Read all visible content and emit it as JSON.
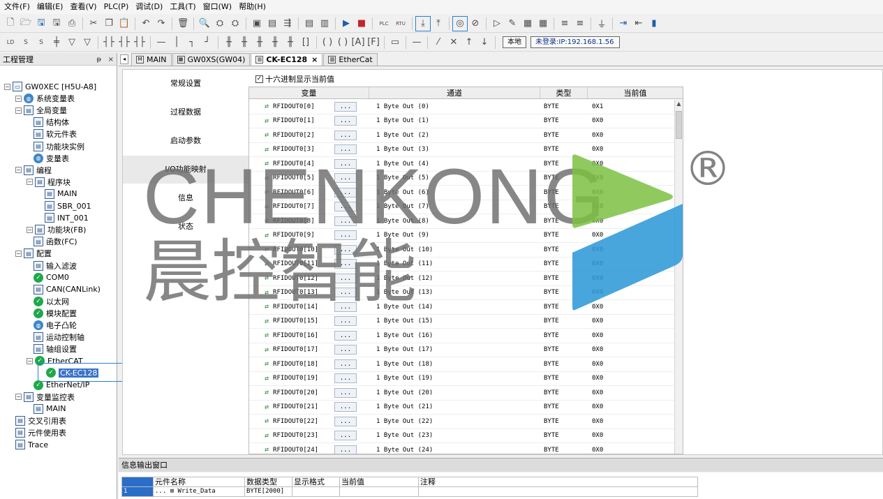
{
  "menu": [
    "文件(F)",
    "编辑(E)",
    "查看(V)",
    "PLC(P)",
    "调试(D)",
    "工具(T)",
    "窗口(W)",
    "帮助(H)"
  ],
  "toolbar": {
    "local_label": "本地",
    "login_label": "未登录:IP:192.168.1.56",
    "plc_label": "PLC",
    "rtu_label": "RTU"
  },
  "tree": {
    "header": "工程管理",
    "pin": "ᵽ",
    "close": "×",
    "nodes": [
      {
        "label": "GW0XEC [H5U-A8]"
      },
      {
        "label": "系统变量表"
      },
      {
        "label": "全局变量"
      },
      {
        "label": "结构体"
      },
      {
        "label": "软元件表"
      },
      {
        "label": "功能块实例"
      },
      {
        "label": "变量表"
      },
      {
        "label": "编程"
      },
      {
        "label": "程序块"
      },
      {
        "label": "MAIN"
      },
      {
        "label": "SBR_001"
      },
      {
        "label": "INT_001"
      },
      {
        "label": "功能块(FB)"
      },
      {
        "label": "函数(FC)"
      },
      {
        "label": "配置"
      },
      {
        "label": "输入滤波"
      },
      {
        "label": "COM0"
      },
      {
        "label": "CAN(CANLink)"
      },
      {
        "label": "以太网"
      },
      {
        "label": "模块配置"
      },
      {
        "label": "电子凸轮"
      },
      {
        "label": "运动控制轴"
      },
      {
        "label": "轴组设置"
      },
      {
        "label": "EtherCAT"
      },
      {
        "label": "CK-EC128"
      },
      {
        "label": "EtherNet/IP"
      },
      {
        "label": "变量监控表"
      },
      {
        "label": "MAIN"
      },
      {
        "label": "交叉引用表"
      },
      {
        "label": "元件使用表"
      },
      {
        "label": "Trace"
      }
    ]
  },
  "tabs": [
    {
      "label": "MAIN"
    },
    {
      "label": "GW0XS(GW04)"
    },
    {
      "label": "CK-EC128",
      "close": "×"
    },
    {
      "label": "EtherCat"
    }
  ],
  "settings_menu": [
    "常规设置",
    "过程数据",
    "启动参数",
    "I/O功能映射",
    "信息",
    "状态"
  ],
  "hex_checkbox": {
    "label": "十六进制显示当前值",
    "check": "✓"
  },
  "grid": {
    "headers": [
      "变量",
      "通道",
      "类型",
      "当前值"
    ],
    "dots": "...",
    "rows": [
      {
        "var": "RFIDOUT0[0]",
        "channel": "1 Byte Out (0)",
        "type": "BYTE",
        "value": "0X1"
      },
      {
        "var": "RFIDOUT0[1]",
        "channel": "1 Byte Out (1)",
        "type": "BYTE",
        "value": "0X0"
      },
      {
        "var": "RFIDOUT0[2]",
        "channel": "1 Byte Out (2)",
        "type": "BYTE",
        "value": "0X0"
      },
      {
        "var": "RFIDOUT0[3]",
        "channel": "1 Byte Out (3)",
        "type": "BYTE",
        "value": "0X0"
      },
      {
        "var": "RFIDOUT0[4]",
        "channel": "1 Byte Out (4)",
        "type": "BYTE",
        "value": "0X0"
      },
      {
        "var": "RFIDOUT0[5]",
        "channel": "1 Byte Out (5)",
        "type": "BYTE",
        "value": "0X0"
      },
      {
        "var": "RFIDOUT0[6]",
        "channel": "1 Byte Out (6)",
        "type": "BYTE",
        "value": "0X0"
      },
      {
        "var": "RFIDOUT0[7]",
        "channel": "1 Byte Out (7)",
        "type": "BYTE",
        "value": "0X0"
      },
      {
        "var": "RFIDOUT0[8]",
        "channel": "1 Byte Out (8)",
        "type": "BYTE",
        "value": "0X0"
      },
      {
        "var": "RFIDOUT0[9]",
        "channel": "1 Byte Out (9)",
        "type": "BYTE",
        "value": "0X0"
      },
      {
        "var": "RFIDOUT0[10]",
        "channel": "1 Byte Out (10)",
        "type": "BYTE",
        "value": "0X0"
      },
      {
        "var": "RFIDOUT0[11]",
        "channel": "1 Byte Out (11)",
        "type": "BYTE",
        "value": "0X0"
      },
      {
        "var": "RFIDOUT0[12]",
        "channel": "1 Byte Out (12)",
        "type": "BYTE",
        "value": "0X0"
      },
      {
        "var": "RFIDOUT0[13]",
        "channel": "1 Byte Out (13)",
        "type": "BYTE",
        "value": "0X0"
      },
      {
        "var": "RFIDOUT0[14]",
        "channel": "1 Byte Out (14)",
        "type": "BYTE",
        "value": "0X0"
      },
      {
        "var": "RFIDOUT0[15]",
        "channel": "1 Byte Out (15)",
        "type": "BYTE",
        "value": "0X0"
      },
      {
        "var": "RFIDOUT0[16]",
        "channel": "1 Byte Out (16)",
        "type": "BYTE",
        "value": "0X0"
      },
      {
        "var": "RFIDOUT0[17]",
        "channel": "1 Byte Out (17)",
        "type": "BYTE",
        "value": "0X0"
      },
      {
        "var": "RFIDOUT0[18]",
        "channel": "1 Byte Out (18)",
        "type": "BYTE",
        "value": "0X0"
      },
      {
        "var": "RFIDOUT0[19]",
        "channel": "1 Byte Out (19)",
        "type": "BYTE",
        "value": "0X0"
      },
      {
        "var": "RFIDOUT0[20]",
        "channel": "1 Byte Out (20)",
        "type": "BYTE",
        "value": "0X0"
      },
      {
        "var": "RFIDOUT0[21]",
        "channel": "1 Byte Out (21)",
        "type": "BYTE",
        "value": "0X0"
      },
      {
        "var": "RFIDOUT0[22]",
        "channel": "1 Byte Out (22)",
        "type": "BYTE",
        "value": "0X0"
      },
      {
        "var": "RFIDOUT0[23]",
        "channel": "1 Byte Out (23)",
        "type": "BYTE",
        "value": "0X0"
      },
      {
        "var": "RFIDOUT0[24]",
        "channel": "1 Byte Out (24)",
        "type": "BYTE",
        "value": "0X0"
      }
    ]
  },
  "output": {
    "title": "信息输出窗口",
    "headers": [
      "",
      "元件名称",
      "数据类型",
      "显示格式",
      "当前值",
      "注释"
    ],
    "row": {
      "index": "1",
      "name": "Write_Data",
      "expand": "⊞",
      "prefix": "...",
      "type": "BYTE[2000]"
    }
  },
  "watermark": {
    "text": "CHENKONG",
    "cn": "晨控智能",
    "reg": "®",
    "green": "#7dc143",
    "blue": "#2f9ad8",
    "gray": "#6d6d6d"
  }
}
